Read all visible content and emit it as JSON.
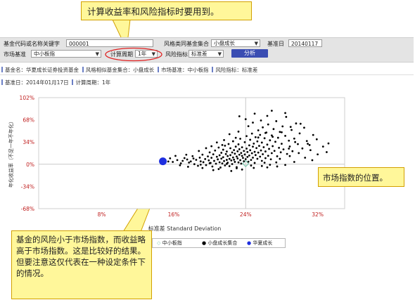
{
  "callouts": {
    "top": "计算收益率和风险指标时要用到。",
    "right": "市场指数的位置。",
    "bottom": "基金的风险小于市场指数，而收益略高于市场指数。这是比较好的结果。但要注意这仅代表在一种设定条件下的情况。"
  },
  "form": {
    "fund_code_label": "基金代码或名称关键字",
    "fund_code_value": "000001",
    "style_set_label": "风格类同基金集合",
    "style_set_value": "小盘成长",
    "base_date_label": "基准日",
    "base_date_value": "20140117",
    "market_index_label": "市场基准",
    "market_index_value": "中小板指",
    "period_label": "计算周期",
    "period_value": "1年",
    "risk_label": "风险指标",
    "risk_value": "标准差",
    "analyze_button": "分析"
  },
  "info_line1": {
    "fund_name": "基金名：华夏成长证券投资基金",
    "style_set": "风格相似基金集合：小盘成长",
    "market": "市场基准：中小板指",
    "risk": "风险指标：标准差"
  },
  "info_line2": {
    "base_date": "基准日：2014年01月17日",
    "period": "计算周期：1年"
  },
  "chart_data": {
    "type": "scatter",
    "ylabel": "年化收益率（不足一年不年化）",
    "xlabel": "标准差 Standard Deviation",
    "x_ticks": [
      "8%",
      "16%",
      "24%",
      "32%"
    ],
    "y_ticks": [
      "102%",
      "68%",
      "34%",
      "0%",
      "-34%",
      "-68%"
    ],
    "xlim": [
      1,
      35
    ],
    "ylim": [
      -68,
      102
    ],
    "legend_position": "bottom",
    "series": [
      {
        "name": "中小板指",
        "color": "#7fc9b0",
        "marker": "diamond-icon",
        "points": [
          [
            24.0,
            1.0
          ]
        ]
      },
      {
        "name": "小盘成长集合",
        "color": "#000000",
        "marker": "dot-icon",
        "points": [
          [
            15.6,
            9.1
          ],
          [
            15.9,
            3.5
          ],
          [
            16.4,
            6.4
          ],
          [
            16.8,
            1.4
          ],
          [
            17.0,
            5.2
          ],
          [
            17.2,
            9.5
          ],
          [
            17.5,
            7.3
          ],
          [
            17.7,
            2.6
          ],
          [
            17.9,
            4.3
          ],
          [
            18.1,
            12.4
          ],
          [
            18.3,
            0.1
          ],
          [
            18.5,
            6.8
          ],
          [
            18.7,
            -2.4
          ],
          [
            18.9,
            10.1
          ],
          [
            19.0,
            4.4
          ],
          [
            19.2,
            14.7
          ],
          [
            19.3,
            3.2
          ],
          [
            19.5,
            8.0
          ],
          [
            19.6,
            -1.3
          ],
          [
            19.8,
            12.0
          ],
          [
            19.9,
            6.0
          ],
          [
            20.0,
            18.2
          ],
          [
            20.1,
            2.1
          ],
          [
            20.2,
            9.9
          ],
          [
            20.3,
            -3.5
          ],
          [
            20.4,
            15.2
          ],
          [
            20.5,
            5.1
          ],
          [
            20.6,
            21.0
          ],
          [
            20.7,
            0.8
          ],
          [
            20.8,
            11.5
          ],
          [
            20.9,
            7.5
          ],
          [
            21.0,
            25.6
          ],
          [
            21.1,
            3.0
          ],
          [
            21.1,
            13.8
          ],
          [
            21.2,
            -5.0
          ],
          [
            21.3,
            17.6
          ],
          [
            21.3,
            8.7
          ],
          [
            21.4,
            1.2
          ],
          [
            21.5,
            22.3
          ],
          [
            21.5,
            10.8
          ],
          [
            21.6,
            4.9
          ],
          [
            21.7,
            28.4
          ],
          [
            21.7,
            -1.8
          ],
          [
            21.8,
            15.6
          ],
          [
            21.9,
            6.7
          ],
          [
            21.9,
            19.5
          ],
          [
            22.0,
            2.4
          ],
          [
            22.0,
            12.5
          ],
          [
            22.1,
            31.0
          ],
          [
            22.2,
            8.2
          ],
          [
            22.2,
            -2.9
          ],
          [
            22.3,
            24.5
          ],
          [
            22.3,
            14.0
          ],
          [
            22.4,
            5.8
          ],
          [
            22.5,
            18.1
          ],
          [
            22.5,
            0.3
          ],
          [
            22.6,
            10.4
          ],
          [
            22.6,
            35.2
          ],
          [
            22.7,
            21.7
          ],
          [
            22.7,
            7.0
          ],
          [
            22.8,
            16.2
          ],
          [
            22.8,
            3.6
          ],
          [
            22.9,
            27.0
          ],
          [
            23.0,
            11.9
          ],
          [
            23.0,
            -6.2
          ],
          [
            23.1,
            19.8
          ],
          [
            23.1,
            8.9
          ],
          [
            23.2,
            2.8
          ],
          [
            23.2,
            30.5
          ],
          [
            23.3,
            14.6
          ],
          [
            23.3,
            23.0
          ],
          [
            23.4,
            6.3
          ],
          [
            23.4,
            39.0
          ],
          [
            23.5,
            17.3
          ],
          [
            23.5,
            1.0
          ],
          [
            23.6,
            12.8
          ],
          [
            23.6,
            26.0
          ],
          [
            23.7,
            9.7
          ],
          [
            23.8,
            20.4
          ],
          [
            23.8,
            4.6
          ],
          [
            23.9,
            33.8
          ],
          [
            23.9,
            15.0
          ],
          [
            24.0,
            7.8
          ],
          [
            24.1,
            24.0
          ],
          [
            24.1,
            43.1
          ],
          [
            24.2,
            11.2
          ],
          [
            24.2,
            18.7
          ],
          [
            24.3,
            3.9
          ],
          [
            24.4,
            29.0
          ],
          [
            24.4,
            13.4
          ],
          [
            24.5,
            37.5
          ],
          [
            24.5,
            21.5
          ],
          [
            24.6,
            6.6
          ],
          [
            24.7,
            16.8
          ],
          [
            24.7,
            47.0
          ],
          [
            24.8,
            26.9
          ],
          [
            24.8,
            10.1
          ],
          [
            24.9,
            31.7
          ],
          [
            25.0,
            19.0
          ],
          [
            25.0,
            2.0
          ],
          [
            25.1,
            41.5
          ],
          [
            25.1,
            14.1
          ],
          [
            25.2,
            24.8
          ],
          [
            25.3,
            8.4
          ],
          [
            25.3,
            35.0
          ],
          [
            25.4,
            52.0
          ],
          [
            25.4,
            17.9
          ],
          [
            25.5,
            28.2
          ],
          [
            25.6,
            11.6
          ],
          [
            25.6,
            45.0
          ],
          [
            25.7,
            21.2
          ],
          [
            25.8,
            5.2
          ],
          [
            25.8,
            33.2
          ],
          [
            25.9,
            56.5
          ],
          [
            25.9,
            15.4
          ],
          [
            26.0,
            26.1
          ],
          [
            26.1,
            39.8
          ],
          [
            26.2,
            9.3
          ],
          [
            26.2,
            19.6
          ],
          [
            26.3,
            48.6
          ],
          [
            26.4,
            30.1
          ],
          [
            26.5,
            13.0
          ],
          [
            26.5,
            61.0
          ],
          [
            26.6,
            23.5
          ],
          [
            26.7,
            36.7
          ],
          [
            26.8,
            7.6
          ],
          [
            26.9,
            44.2
          ],
          [
            26.9,
            17.0
          ],
          [
            27.0,
            27.7
          ],
          [
            27.1,
            53.9
          ],
          [
            27.2,
            20.5
          ],
          [
            27.3,
            34.4
          ],
          [
            27.4,
            66.0
          ],
          [
            27.5,
            12.2
          ],
          [
            27.6,
            40.6
          ],
          [
            27.7,
            25.2
          ],
          [
            27.8,
            49.5
          ],
          [
            27.9,
            18.3
          ],
          [
            28.0,
            31.4
          ],
          [
            28.1,
            58.0
          ],
          [
            28.2,
            22.8
          ],
          [
            28.4,
            43.5
          ],
          [
            28.5,
            72.5
          ],
          [
            28.6,
            15.8
          ],
          [
            28.8,
            36.1
          ],
          [
            28.9,
            27.2
          ],
          [
            29.1,
            52.5
          ],
          [
            29.2,
            20.0
          ],
          [
            29.4,
            39.3
          ],
          [
            29.6,
            62.5
          ],
          [
            29.8,
            30.8
          ],
          [
            30.0,
            47.2
          ],
          [
            30.3,
            24.2
          ],
          [
            30.5,
            56.0
          ],
          [
            30.8,
            35.6
          ],
          [
            31.1,
            29.5
          ],
          [
            31.5,
            44.8
          ],
          [
            31.9,
            38.2
          ],
          [
            20.4,
            -9.0
          ],
          [
            21.0,
            -7.4
          ],
          [
            22.4,
            -10.3
          ],
          [
            23.6,
            -8.1
          ],
          [
            24.9,
            -5.6
          ],
          [
            25.8,
            -2.7
          ],
          [
            26.7,
            -0.8
          ],
          [
            27.4,
            2.9
          ],
          [
            19.2,
            -5.7
          ],
          [
            17.6,
            -3.9
          ],
          [
            16.7,
            -1.6
          ],
          [
            18.2,
            8.8
          ],
          [
            21.4,
            29.5
          ],
          [
            22.9,
            40.5
          ],
          [
            24.3,
            58.3
          ],
          [
            25.7,
            67.0
          ],
          [
            26.4,
            74.0
          ],
          [
            24.8,
            63.8
          ],
          [
            23.2,
            50.0
          ],
          [
            20.8,
            33.4
          ],
          [
            19.6,
            24.6
          ],
          [
            18.8,
            20.3
          ],
          [
            17.4,
            14.6
          ],
          [
            16.2,
            12.8
          ],
          [
            15.4,
            4.2
          ],
          [
            27.8,
            8.3
          ],
          [
            28.9,
            12.5
          ],
          [
            29.9,
            17.1
          ],
          [
            30.6,
            10.0
          ],
          [
            31.2,
            21.6
          ],
          [
            32.6,
            27.1
          ],
          [
            33.2,
            31.9
          ],
          [
            26.1,
            2.3
          ],
          [
            24.6,
            -1.9
          ],
          [
            23.0,
            -4.4
          ],
          [
            21.9,
            0.5
          ],
          [
            20.0,
            1.6
          ],
          [
            19.0,
            -0.6
          ],
          [
            25.4,
            41.0
          ],
          [
            26.2,
            47.9
          ],
          [
            27.0,
            42.0
          ],
          [
            28.0,
            49.0
          ],
          [
            29.0,
            57.2
          ],
          [
            30.1,
            62.0
          ],
          [
            24.0,
            69.0
          ],
          [
            25.0,
            77.5
          ],
          [
            26.9,
            82.0
          ],
          [
            23.3,
            73.5
          ],
          [
            28.4,
            78.5
          ],
          [
            22.2,
            46.0
          ],
          [
            21.6,
            37.0
          ],
          [
            20.2,
            27.6
          ],
          [
            32.0,
            15.1
          ],
          [
            31.4,
            6.2
          ],
          [
            29.4,
            3.5
          ],
          [
            28.4,
            -1.0
          ],
          [
            27.5,
            -3.4
          ],
          [
            26.4,
            -4.8
          ],
          [
            33.0,
            18.6
          ],
          [
            30.9,
            31.4
          ],
          [
            29.5,
            34.0
          ],
          [
            28.8,
            24.0
          ]
        ]
      },
      {
        "name": "华夏成长",
        "color": "#1f2fdf",
        "marker": "circle-icon",
        "points": [
          [
            14.8,
            4.5
          ]
        ]
      }
    ]
  }
}
